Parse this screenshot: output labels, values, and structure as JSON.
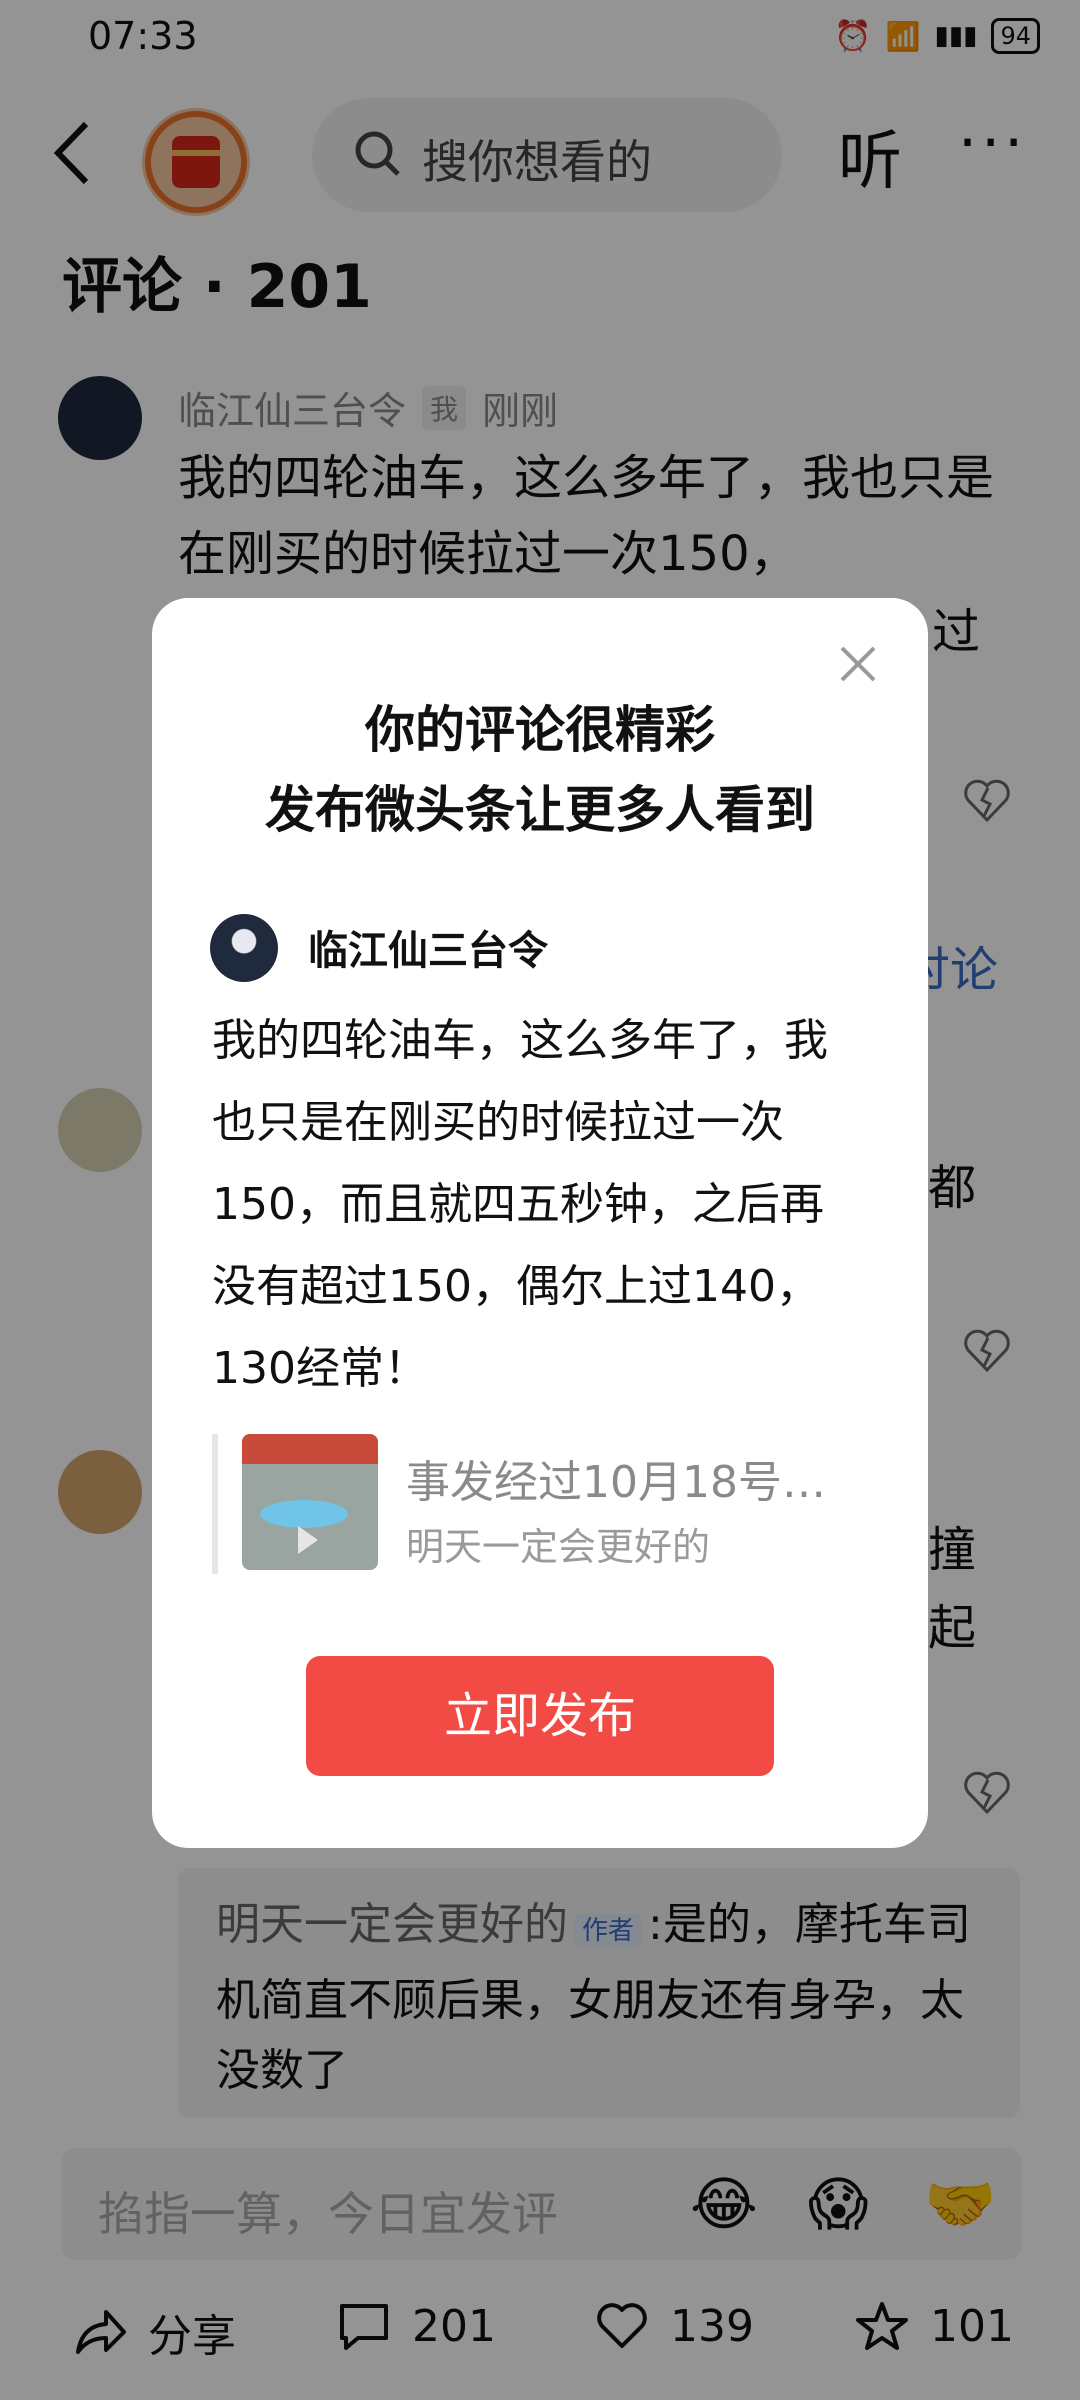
{
  "status": {
    "time": "07:33",
    "battery": "94"
  },
  "header": {
    "search_placeholder": "搜你想看的",
    "listen_label": "听",
    "more_label": "···"
  },
  "comments_header": {
    "title": "评论 · 201"
  },
  "comments": [
    {
      "name": "临江仙三台令",
      "badge": "我",
      "time": "刚刚",
      "text": "我的四轮油车，这么多年了，我也只是在刚买的时候拉过一次150，",
      "tail_glyph": "过"
    }
  ],
  "background_fragments": {
    "discuss": "讨论",
    "frag1": "都",
    "frag2": "撞",
    "frag3": "起"
  },
  "reply": {
    "name": "明天一定会更好的",
    "badge": "作者",
    "text": ":是的，摩托车司机简直不顾后果，女朋友还有身孕，太没数了"
  },
  "comment_input": {
    "placeholder": "掐指一算，今日宜发评"
  },
  "bottom_bar": {
    "share": "分享",
    "comments": "201",
    "likes": "139",
    "favorites": "101"
  },
  "modal": {
    "title_line1": "你的评论很精彩",
    "title_line2": "发布微头条让更多人看到",
    "username": "临江仙三台令",
    "text": "我的四轮油车，这么多年了，我也只是在刚买的时候拉过一次150，而且就四五秒钟，之后再没有超过150，偶尔上过140，130经常！",
    "quote_title": "事发经过10月18号…",
    "quote_author": "明天一定会更好的",
    "publish_button": "立即发布"
  },
  "colors": {
    "accent_red": "#f24a45",
    "author_blue": "#3a6cc7"
  }
}
